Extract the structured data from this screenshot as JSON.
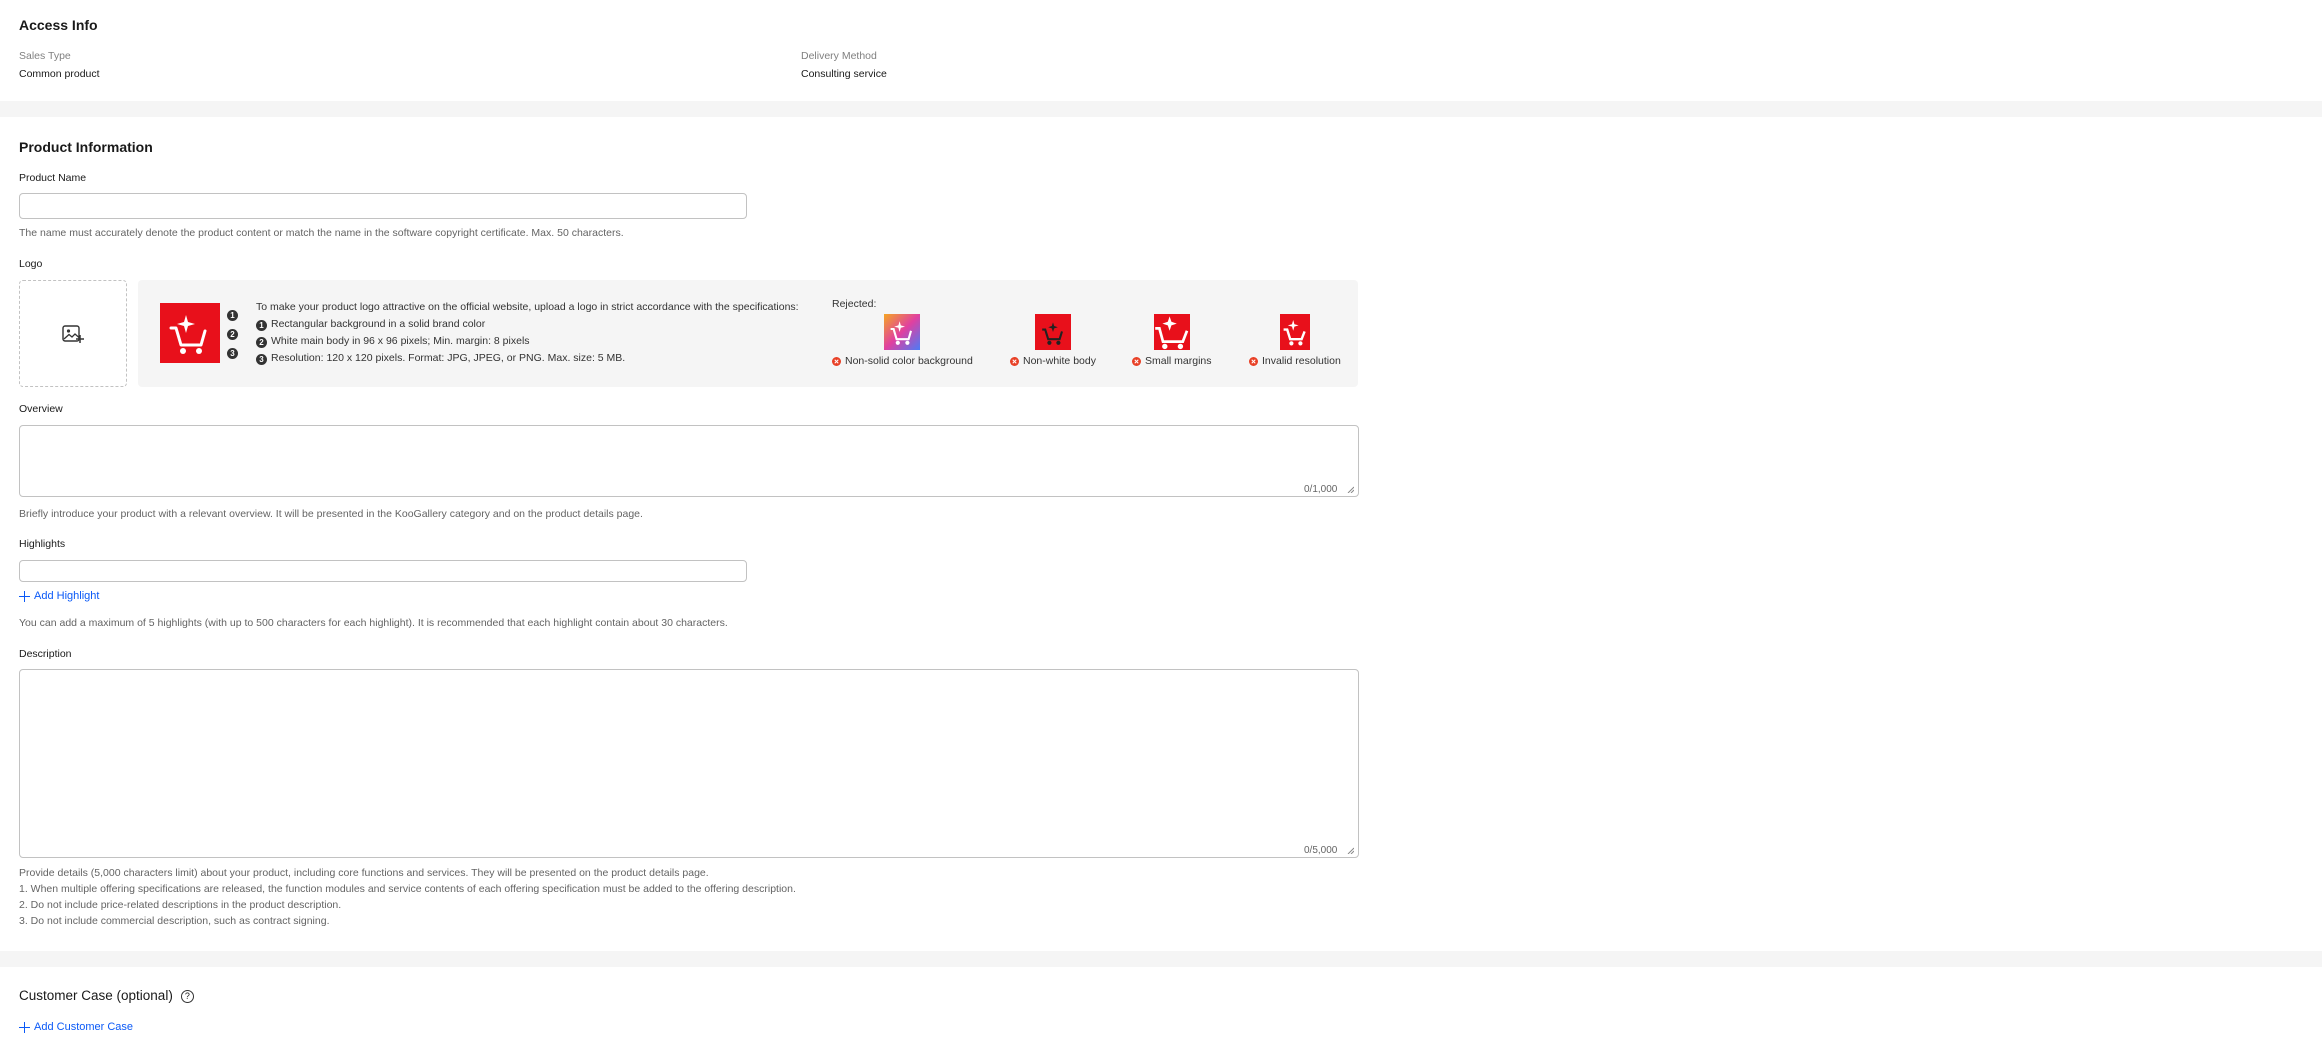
{
  "access_info": {
    "title": "Access Info",
    "sales_type_label": "Sales Type",
    "sales_type_value": "Common product",
    "delivery_method_label": "Delivery Method",
    "delivery_method_value": "Consulting service"
  },
  "product_info": {
    "title": "Product Information",
    "product_name": {
      "label": "Product Name",
      "value": "",
      "hint": "The name must accurately denote the product content or match the name in the software copyright certificate. Max. 50 characters."
    },
    "logo": {
      "label": "Logo",
      "upload_icon": "image-add-icon",
      "spec_intro": "To make your product logo attractive on the official website, upload a logo in strict accordance with the specifications:",
      "spec_numbers": [
        "1",
        "2",
        "3"
      ],
      "specs": [
        "Rectangular background in a solid brand color",
        "White main body in 96 x 96 pixels; Min. margin: 8 pixels",
        "Resolution: 120 x 120 pixels. Format: JPG, JPEG, or PNG. Max. size: 5 MB."
      ],
      "rejected_label": "Rejected:",
      "rejected": [
        "Non-solid color background",
        "Non-white body",
        "Small margins",
        "Invalid resolution"
      ],
      "brand_color": "#e8101b"
    },
    "overview": {
      "label": "Overview",
      "value": "",
      "counter": "0/1,000",
      "hint": "Briefly introduce your product with a relevant overview. It will be presented in the KooGallery category and on the product details page."
    },
    "highlights": {
      "label": "Highlights",
      "value": "",
      "add_label": "Add Highlight",
      "hint": "You can add a maximum of 5 highlights (with up to 500 characters for each highlight). It is recommended that each highlight contain about 30 characters."
    },
    "description": {
      "label": "Description",
      "value": "",
      "counter": "0/5,000",
      "hints": [
        "Provide details (5,000 characters limit) about your product, including core functions and services. They will be presented on the product details page.",
        "1. When multiple offering specifications are released, the function modules and service contents of each offering specification must be added to the offering description.",
        "2. Do not include price-related descriptions in the product description.",
        "3. Do not include commercial description, such as contract signing."
      ]
    }
  },
  "customer_case": {
    "title": "Customer Case (optional)",
    "help_icon": "question-circle-icon",
    "add_label": "Add Customer Case"
  },
  "colors": {
    "link": "#0a59f7",
    "error": "#e84026",
    "separator": "#f5f5f5"
  }
}
